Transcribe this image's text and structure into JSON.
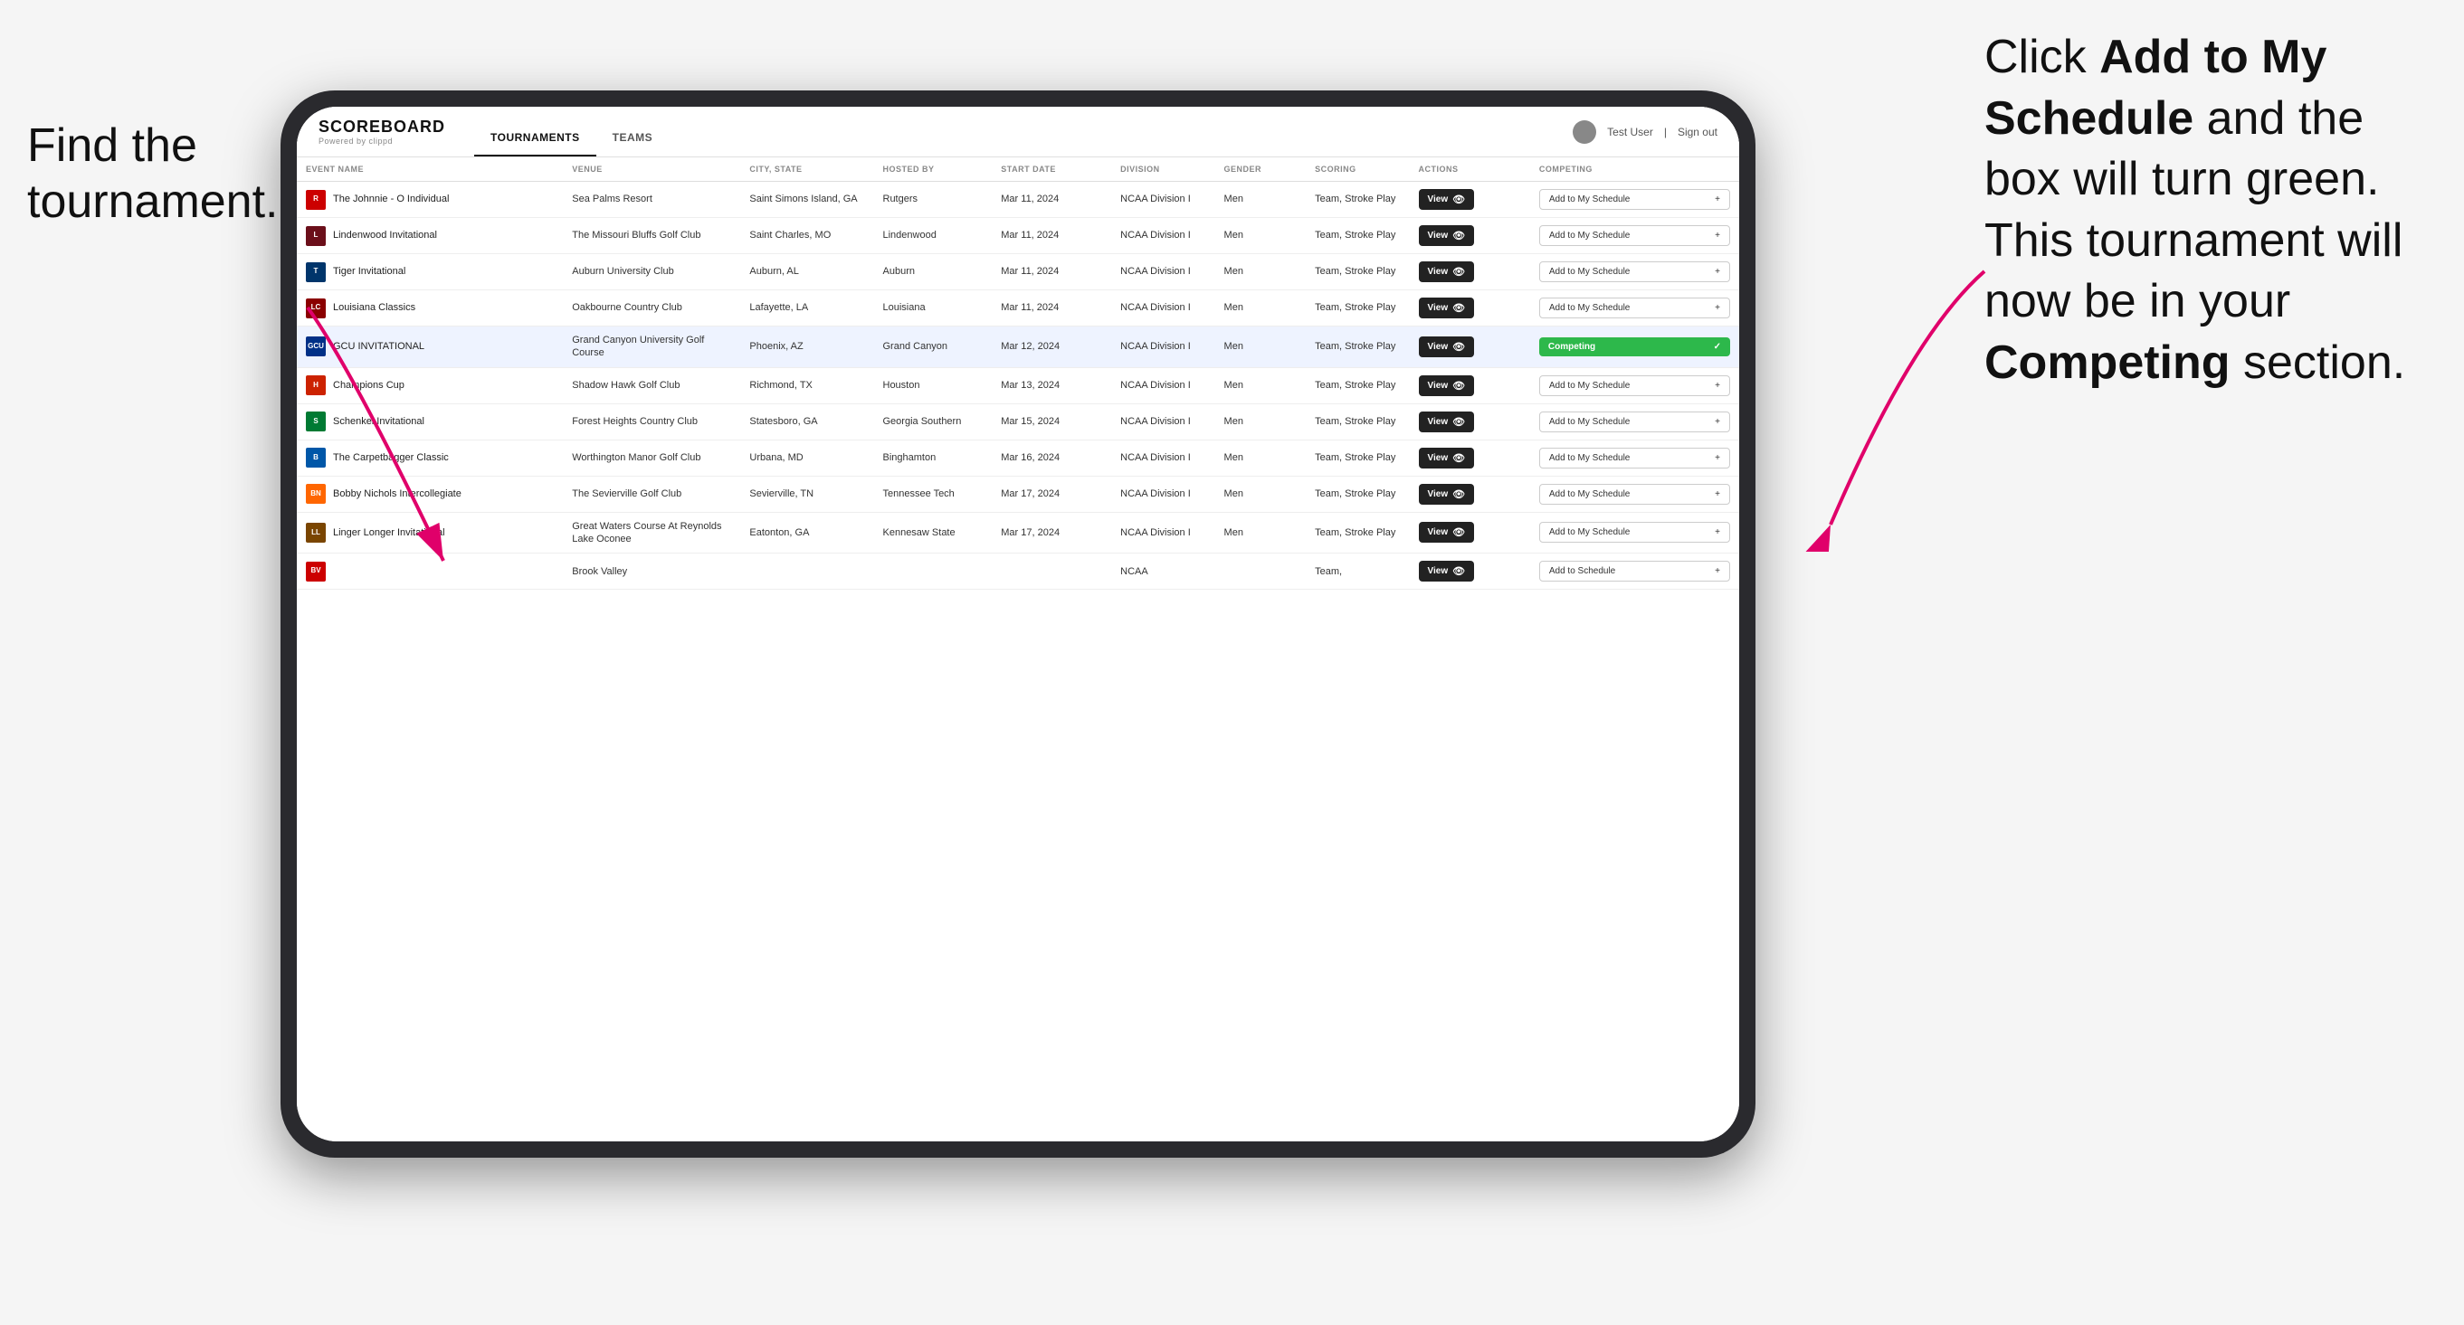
{
  "annotations": {
    "left": "Find the\ntournament.",
    "right_line1": "Click ",
    "right_bold1": "Add to My\nSchedule",
    "right_line2": " and the\nbox will turn green.\nThis tournament\nwill now be in\nyour ",
    "right_bold2": "Competing",
    "right_line3": "\nsection."
  },
  "navbar": {
    "logo": "SCOREBOARD",
    "logo_sub": "Powered by clippd",
    "tabs": [
      "TOURNAMENTS",
      "TEAMS"
    ],
    "active_tab": "TOURNAMENTS",
    "user": "Test User",
    "sign_out": "Sign out"
  },
  "table": {
    "columns": [
      "EVENT NAME",
      "VENUE",
      "CITY, STATE",
      "HOSTED BY",
      "START DATE",
      "DIVISION",
      "GENDER",
      "SCORING",
      "ACTIONS",
      "COMPETING"
    ],
    "rows": [
      {
        "logo_color": "logo-red",
        "logo_letter": "R",
        "event": "The Johnnie - O Individual",
        "venue": "Sea Palms Resort",
        "city": "Saint Simons Island, GA",
        "hosted": "Rutgers",
        "date": "Mar 11, 2024",
        "division": "NCAA Division I",
        "gender": "Men",
        "scoring": "Team, Stroke Play",
        "action": "View",
        "competing": "Add to My Schedule",
        "is_competing": false
      },
      {
        "logo_color": "logo-maroon",
        "logo_letter": "L",
        "event": "Lindenwood Invitational",
        "venue": "The Missouri Bluffs Golf Club",
        "city": "Saint Charles, MO",
        "hosted": "Lindenwood",
        "date": "Mar 11, 2024",
        "division": "NCAA Division I",
        "gender": "Men",
        "scoring": "Team, Stroke Play",
        "action": "View",
        "competing": "Add to My Schedule",
        "is_competing": false
      },
      {
        "logo_color": "logo-blue-gold",
        "logo_letter": "T",
        "event": "Tiger Invitational",
        "venue": "Auburn University Club",
        "city": "Auburn, AL",
        "hosted": "Auburn",
        "date": "Mar 11, 2024",
        "division": "NCAA Division I",
        "gender": "Men",
        "scoring": "Team, Stroke Play",
        "action": "View",
        "competing": "Add to My Schedule",
        "is_competing": false
      },
      {
        "logo_color": "logo-dark-red",
        "logo_letter": "LC",
        "event": "Louisiana Classics",
        "venue": "Oakbourne Country Club",
        "city": "Lafayette, LA",
        "hosted": "Louisiana",
        "date": "Mar 11, 2024",
        "division": "NCAA Division I",
        "gender": "Men",
        "scoring": "Team, Stroke Play",
        "action": "View",
        "competing": "Add to My Schedule",
        "is_competing": false
      },
      {
        "logo_color": "logo-navy",
        "logo_letter": "GCU",
        "event": "GCU INVITATIONAL",
        "venue": "Grand Canyon University Golf Course",
        "city": "Phoenix, AZ",
        "hosted": "Grand Canyon",
        "date": "Mar 12, 2024",
        "division": "NCAA Division I",
        "gender": "Men",
        "scoring": "Team, Stroke Play",
        "action": "View",
        "competing": "Competing",
        "is_competing": true
      },
      {
        "logo_color": "logo-red2",
        "logo_letter": "H",
        "event": "Champions Cup",
        "venue": "Shadow Hawk Golf Club",
        "city": "Richmond, TX",
        "hosted": "Houston",
        "date": "Mar 13, 2024",
        "division": "NCAA Division I",
        "gender": "Men",
        "scoring": "Team, Stroke Play",
        "action": "View",
        "competing": "Add to My Schedule",
        "is_competing": false
      },
      {
        "logo_color": "logo-green",
        "logo_letter": "S",
        "event": "Schenkel Invitational",
        "venue": "Forest Heights Country Club",
        "city": "Statesboro, GA",
        "hosted": "Georgia Southern",
        "date": "Mar 15, 2024",
        "division": "NCAA Division I",
        "gender": "Men",
        "scoring": "Team, Stroke Play",
        "action": "View",
        "competing": "Add to My Schedule",
        "is_competing": false
      },
      {
        "logo_color": "logo-blue",
        "logo_letter": "B",
        "event": "The Carpetbagger Classic",
        "venue": "Worthington Manor Golf Club",
        "city": "Urbana, MD",
        "hosted": "Binghamton",
        "date": "Mar 16, 2024",
        "division": "NCAA Division I",
        "gender": "Men",
        "scoring": "Team, Stroke Play",
        "action": "View",
        "competing": "Add to My Schedule",
        "is_competing": false
      },
      {
        "logo_color": "logo-orange",
        "logo_letter": "BN",
        "event": "Bobby Nichols Intercollegiate",
        "venue": "The Sevierville Golf Club",
        "city": "Sevierville, TN",
        "hosted": "Tennessee Tech",
        "date": "Mar 17, 2024",
        "division": "NCAA Division I",
        "gender": "Men",
        "scoring": "Team, Stroke Play",
        "action": "View",
        "competing": "Add to My Schedule",
        "is_competing": false
      },
      {
        "logo_color": "logo-brown",
        "logo_letter": "LL",
        "event": "Linger Longer Invitational",
        "venue": "Great Waters Course At Reynolds Lake Oconee",
        "city": "Eatonton, GA",
        "hosted": "Kennesaw State",
        "date": "Mar 17, 2024",
        "division": "NCAA Division I",
        "gender": "Men",
        "scoring": "Team, Stroke Play",
        "action": "View",
        "competing": "Add to My Schedule",
        "is_competing": false
      },
      {
        "logo_color": "logo-red",
        "logo_letter": "BV",
        "event": "",
        "venue": "Brook Valley",
        "city": "",
        "hosted": "",
        "date": "",
        "division": "NCAA",
        "gender": "",
        "scoring": "Team,",
        "action": "View",
        "competing": "Add to Schedule",
        "is_competing": false
      }
    ]
  },
  "buttons": {
    "view": "View",
    "add_to_my_schedule": "Add to My Schedule",
    "add_to_schedule": "Add to Schedule",
    "competing": "Competing"
  },
  "icons": {
    "eye": "👁",
    "plus": "+",
    "check": "✓"
  }
}
